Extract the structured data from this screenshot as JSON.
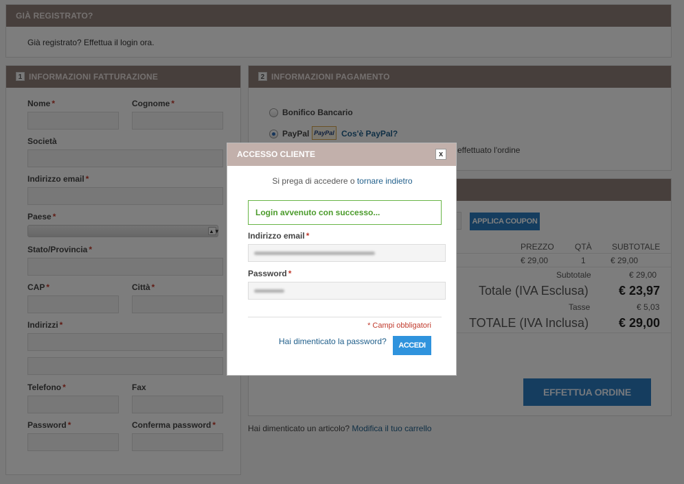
{
  "registered": {
    "title": "GIÀ REGISTRATO?",
    "text": "Già registrato? Effettua il login ora."
  },
  "billing": {
    "number": "1",
    "title": "INFORMAZIONI FATTURAZIONE",
    "fields": {
      "nome": "Nome",
      "cognome": "Cognome",
      "societa": "Società",
      "email": "Indirizzo email",
      "paese": "Paese",
      "stato": "Stato/Provincia",
      "cap": "CAP",
      "citta": "Città",
      "indirizzi": "Indirizzi",
      "telefono": "Telefono",
      "fax": "Fax",
      "password": "Password",
      "conferma": "Conferma password"
    },
    "required_mark": "*"
  },
  "payment": {
    "number": "2",
    "title": "INFORMAZIONI PAGAMENTO",
    "options": {
      "bank": "Bonifico Bancario",
      "paypal": "PayPal",
      "paypal_logo": "PayPal",
      "paypal_info": "Cos'è PayPal?"
    },
    "note": "effettuato l'ordine"
  },
  "review": {
    "apply_coupon": "APPLICA COUPON",
    "headers": {
      "price": "PREZZO",
      "qty": "QTÀ",
      "subtotal": "SUBTOTALE"
    },
    "item": {
      "price": "€ 29,00",
      "qty": "1",
      "subtotal": "€ 29,00"
    },
    "totals": {
      "subtotal_label": "Subtotale",
      "subtotal_value": "€ 29,00",
      "total_excl_label": "Totale (IVA Esclusa)",
      "total_excl_value": "€ 23,97",
      "tax_label": "Tasse",
      "tax_value": "€ 5,03",
      "total_incl_label": "TOTALE (IVA Inclusa)",
      "total_incl_value": "€ 29,00"
    },
    "order_button": "EFFETTUA ORDINE"
  },
  "forgot_cart": {
    "prefix": "Hai dimenticato un articolo?",
    "link": "Modifica il tuo carrello"
  },
  "modal": {
    "title": "ACCESSO CLIENTE",
    "close": "x",
    "prompt": "Si prega di accedere o",
    "prompt_link": "tornare indietro",
    "success": "Login avvenuto con successo...",
    "email_label": "Indirizzo email",
    "password_label": "Password",
    "required_note": "* Campi obbligatori",
    "forgot_password": "Hai dimenticato la password?",
    "login_button": "ACCEDI"
  },
  "colors": {
    "panel_header": "#8e7f79",
    "modal_header": "#c2b0ab",
    "button_blue": "#2b7bbf",
    "success_green": "#66b444",
    "required_red": "#c0392b"
  }
}
